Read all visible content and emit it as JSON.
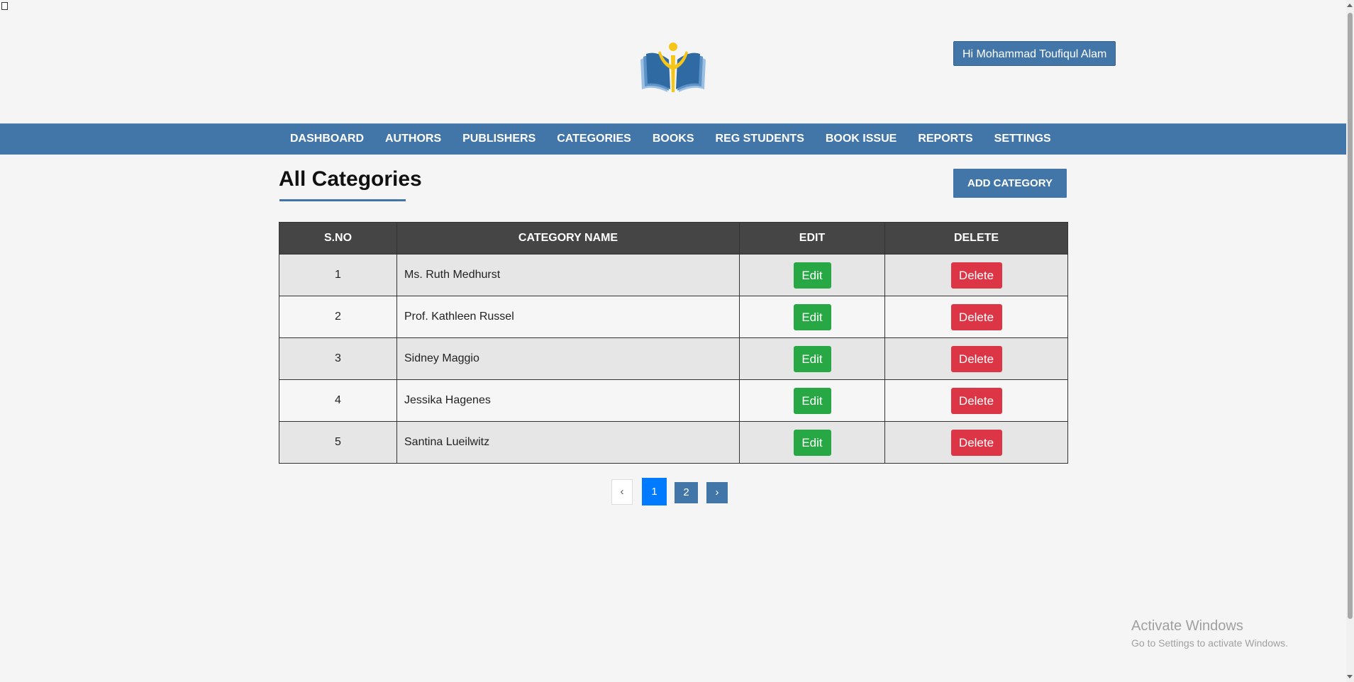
{
  "header": {
    "greeting": "Hi Mohammad Toufiqul Alam",
    "logo_icon": "open-book-reader-logo-icon"
  },
  "nav": {
    "items": [
      "DASHBOARD",
      "AUTHORS",
      "PUBLISHERS",
      "CATEGORIES",
      "BOOKS",
      "REG STUDENTS",
      "BOOK ISSUE",
      "REPORTS",
      "SETTINGS"
    ]
  },
  "main": {
    "title": "All Categories",
    "add_button": "ADD CATEGORY"
  },
  "table": {
    "headers": {
      "sno": "S.NO",
      "name": "CATEGORY NAME",
      "edit": "EDIT",
      "delete": "DELETE"
    },
    "rows": [
      {
        "sno": "1",
        "name": "Ms. Ruth Medhurst",
        "edit": "Edit",
        "delete": "Delete"
      },
      {
        "sno": "2",
        "name": "Prof. Kathleen Russel",
        "edit": "Edit",
        "delete": "Delete"
      },
      {
        "sno": "3",
        "name": "Sidney Maggio",
        "edit": "Edit",
        "delete": "Delete"
      },
      {
        "sno": "4",
        "name": "Jessika Hagenes",
        "edit": "Edit",
        "delete": "Delete"
      },
      {
        "sno": "5",
        "name": "Santina Lueilwitz",
        "edit": "Edit",
        "delete": "Delete"
      }
    ]
  },
  "pagination": {
    "prev": "‹",
    "pages": [
      "1",
      "2"
    ],
    "current": "1",
    "next": "›"
  },
  "watermark": {
    "title": "Activate Windows",
    "subtitle": "Go to Settings to activate Windows."
  },
  "colors": {
    "primary": "#4376a8",
    "table_header": "#454545",
    "edit": "#28a745",
    "delete": "#dc3545",
    "active_page": "#007bff",
    "logo_yellow": "#f5c518"
  }
}
